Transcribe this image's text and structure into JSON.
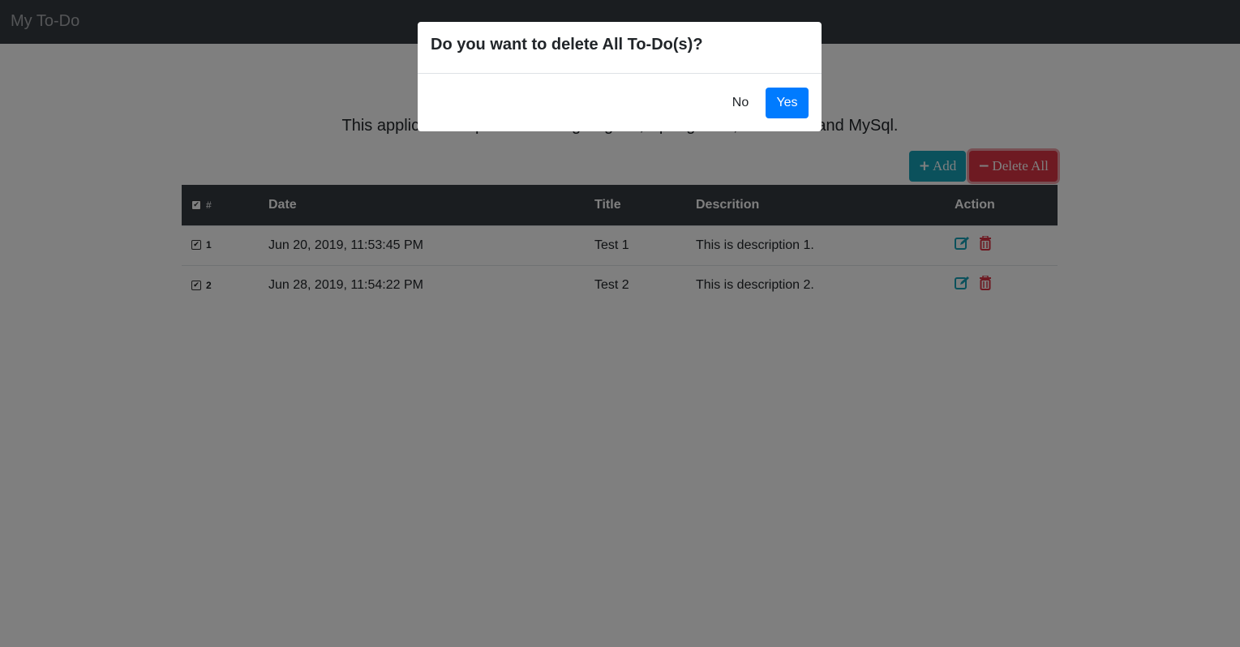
{
  "navbar": {
    "brand": "My To-Do"
  },
  "main": {
    "subtitle": "This application is powered using Angular, Spring Boot, Hibernate and MySql.",
    "add_button": {
      "icon": "plus-icon",
      "label": "Add"
    },
    "delete_all_button": {
      "icon": "minus-icon",
      "label": "Delete All"
    }
  },
  "table": {
    "headers": {
      "number": "#",
      "date": "Date",
      "title": "Title",
      "description": "Descrition",
      "action": "Action"
    },
    "rows": [
      {
        "number": "1",
        "date": "Jun 20, 2019, 11:53:45 PM",
        "title": "Test 1",
        "description": "This is description 1.",
        "checked": true
      },
      {
        "number": "2",
        "date": "Jun 28, 2019, 11:54:22 PM",
        "title": "Test 2",
        "description": "This is description 2.",
        "checked": true
      }
    ]
  },
  "modal": {
    "title": "Do you want to delete All To-Do(s)?",
    "no_label": "No",
    "yes_label": "Yes"
  },
  "colors": {
    "navbar": "#343a40",
    "info": "#17a2b8",
    "danger": "#dc3545",
    "primary": "#007bff"
  }
}
